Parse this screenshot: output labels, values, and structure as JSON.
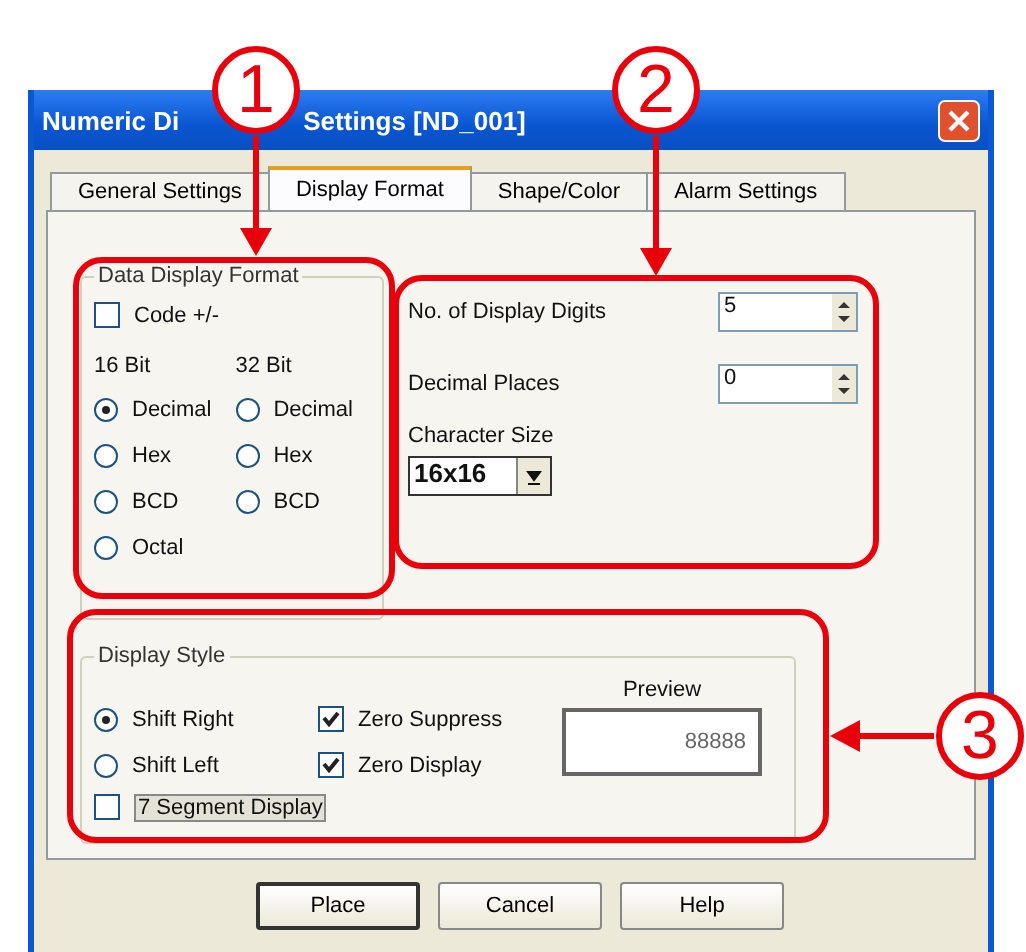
{
  "callouts": [
    {
      "number": "1"
    },
    {
      "number": "2"
    },
    {
      "number": "3"
    }
  ],
  "window": {
    "title_start": "Numeric Di",
    "title_end": "Settings [ND_001]"
  },
  "tabs": [
    {
      "label": "General Settings",
      "selected": false
    },
    {
      "label": "Display Format",
      "selected": true
    },
    {
      "label": "Shape/Color",
      "selected": false
    },
    {
      "label": "Alarm Settings",
      "selected": false
    }
  ],
  "data_display_format": {
    "title": "Data Display Format",
    "code_sign": {
      "label": "Code +/-",
      "checked": false
    },
    "columns": [
      {
        "heading": "16 Bit",
        "options": [
          {
            "label": "Decimal",
            "selected": true
          },
          {
            "label": "Hex",
            "selected": false
          },
          {
            "label": "BCD",
            "selected": false
          },
          {
            "label": "Octal",
            "selected": false
          }
        ]
      },
      {
        "heading": "32 Bit",
        "options": [
          {
            "label": "Decimal",
            "selected": false
          },
          {
            "label": "Hex",
            "selected": false
          },
          {
            "label": "BCD",
            "selected": false
          }
        ]
      }
    ]
  },
  "digits": {
    "label": "No. of Display Digits",
    "value": "5"
  },
  "decimal_places": {
    "label": "Decimal Places",
    "value": "0"
  },
  "character_size": {
    "label": "Character Size",
    "value": "16x16"
  },
  "display_style": {
    "title": "Display Style",
    "shift": [
      {
        "label": "Shift Right",
        "selected": true
      },
      {
        "label": "Shift Left",
        "selected": false
      }
    ],
    "zero": [
      {
        "label": "Zero Suppress",
        "checked": true
      },
      {
        "label": "Zero Display",
        "checked": true
      }
    ],
    "seven_segment": {
      "label": "7 Segment Display",
      "checked": false
    },
    "preview": {
      "label": "Preview",
      "value": "88888"
    }
  },
  "buttons": [
    {
      "label": "Place",
      "default": true
    },
    {
      "label": "Cancel",
      "default": false
    },
    {
      "label": "Help",
      "default": false
    }
  ]
}
